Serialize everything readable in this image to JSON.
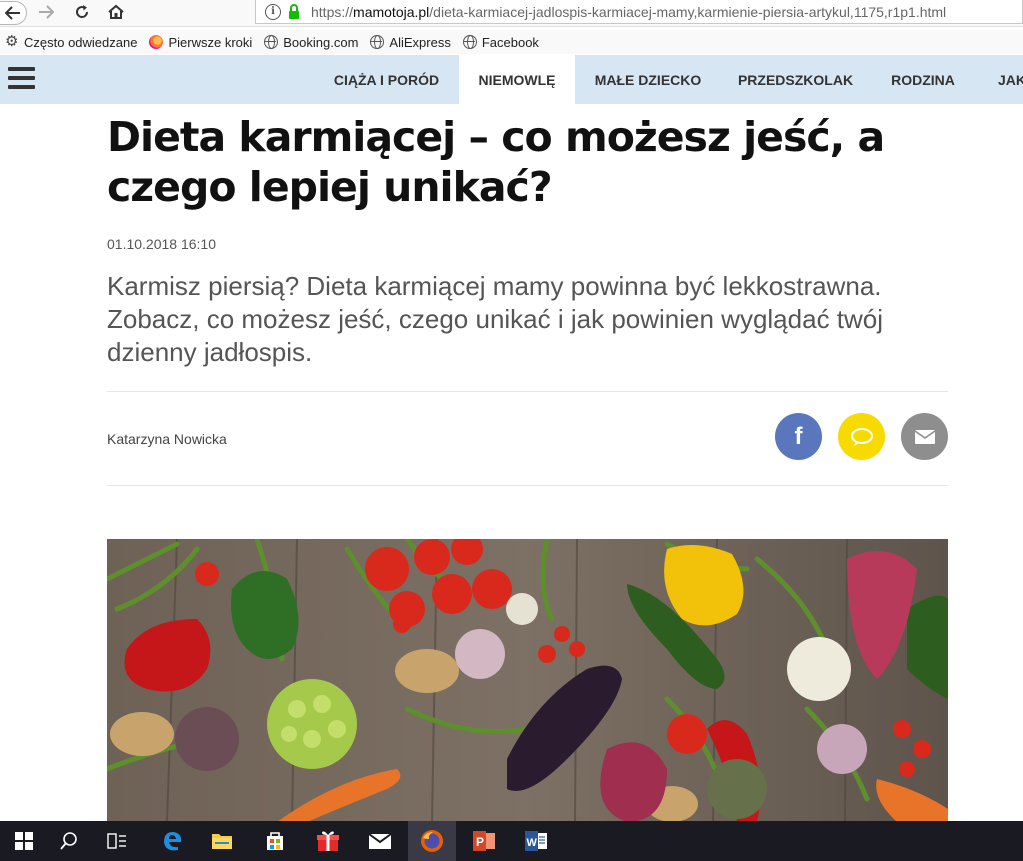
{
  "browser": {
    "url_prefix": "https://",
    "url_domain": "mamotoja.pl",
    "url_path": "/dieta-karmiacej-jadlospis-karmiacej-mamy,karmienie-piersia-artykul,1175,r1p1.html",
    "bookmarks": [
      {
        "label": "Często odwiedzane",
        "icon": "gear-icon"
      },
      {
        "label": "Pierwsze kroki",
        "icon": "firefox-icon"
      },
      {
        "label": "Booking.com",
        "icon": "globe-icon"
      },
      {
        "label": "AliExpress",
        "icon": "globe-icon"
      },
      {
        "label": "Facebook",
        "icon": "globe-icon"
      }
    ]
  },
  "site_nav": {
    "tabs": [
      {
        "label": "CIĄŻA I PORÓD",
        "active": false
      },
      {
        "label": "NIEMOWLĘ",
        "active": true
      },
      {
        "label": "MAŁE DZIECKO",
        "active": false
      },
      {
        "label": "PRZEDSZKOLAK",
        "active": false
      },
      {
        "label": "RODZINA",
        "active": false
      },
      {
        "label": "JAK",
        "active": false
      }
    ]
  },
  "article": {
    "title": "Dieta karmiącej – co możesz jeść, a czego lepiej unikać?",
    "date": "01.10.2018 16:10",
    "lead": "Karmisz piersią? Dieta karmiącej mamy powinna być lekkostrawna. Zobacz, co możesz jeść, czego unikać i jak powinien wyglądać twój dzienny jadłospis.",
    "author": "Katarzyna Nowicka",
    "share_facebook_glyph": "f"
  },
  "colors": {
    "nav_bg": "#d6e7f3",
    "facebook": "#5a76bd",
    "message": "#f7db00",
    "mail": "#8e8e8e"
  },
  "taskbar": {
    "items": [
      "windows-start-icon",
      "search-icon",
      "task-view-icon",
      "edge-icon",
      "file-explorer-icon",
      "store-icon",
      "gift-icon",
      "mail-app-icon",
      "firefox-icon",
      "powerpoint-icon",
      "word-icon"
    ],
    "active": "firefox-icon"
  }
}
